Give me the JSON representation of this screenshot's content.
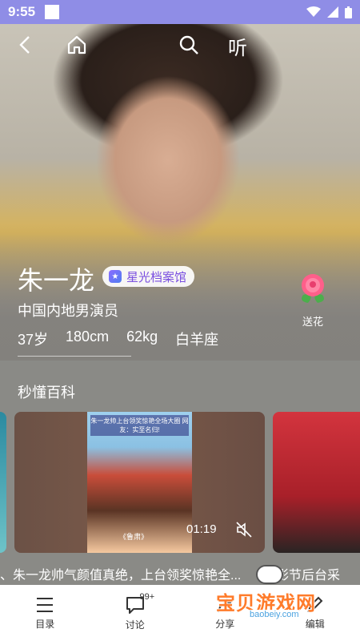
{
  "status_bar": {
    "time": "9:55"
  },
  "nav": {
    "listen_label": "听"
  },
  "profile": {
    "name": "朱一龙",
    "badge": "星光档案馆",
    "description": "中国内地男演员",
    "stats": [
      "37岁",
      "180cm",
      "62kg",
      "白羊座"
    ],
    "flower_label": "送花"
  },
  "section": {
    "title": "秒懂百科"
  },
  "video": {
    "thumb_caption": "朱一龙帅上台领奖惊艳全场大圈 网友：实至名归!",
    "thumb_bottom": "《鲁肃》",
    "duration": "01:19",
    "title": "、朱一龙帅气颜值真绝，上台领奖惊艳全...",
    "next_title": "影节后台采"
  },
  "tabbar": {
    "items": [
      {
        "label": "目录",
        "icon": "catalog-icon"
      },
      {
        "label": "讨论",
        "icon": "comment-icon",
        "badge": "99+"
      },
      {
        "label": "分享",
        "icon": "share-icon"
      },
      {
        "label": "编辑",
        "icon": "edit-icon"
      }
    ]
  },
  "watermark": {
    "title": "宝贝游戏网",
    "url": "baobeiy.com"
  },
  "colors": {
    "status_bar": "#8f8de6",
    "badge_text": "#7a4fe0",
    "watermark": "#ff7b2a"
  }
}
